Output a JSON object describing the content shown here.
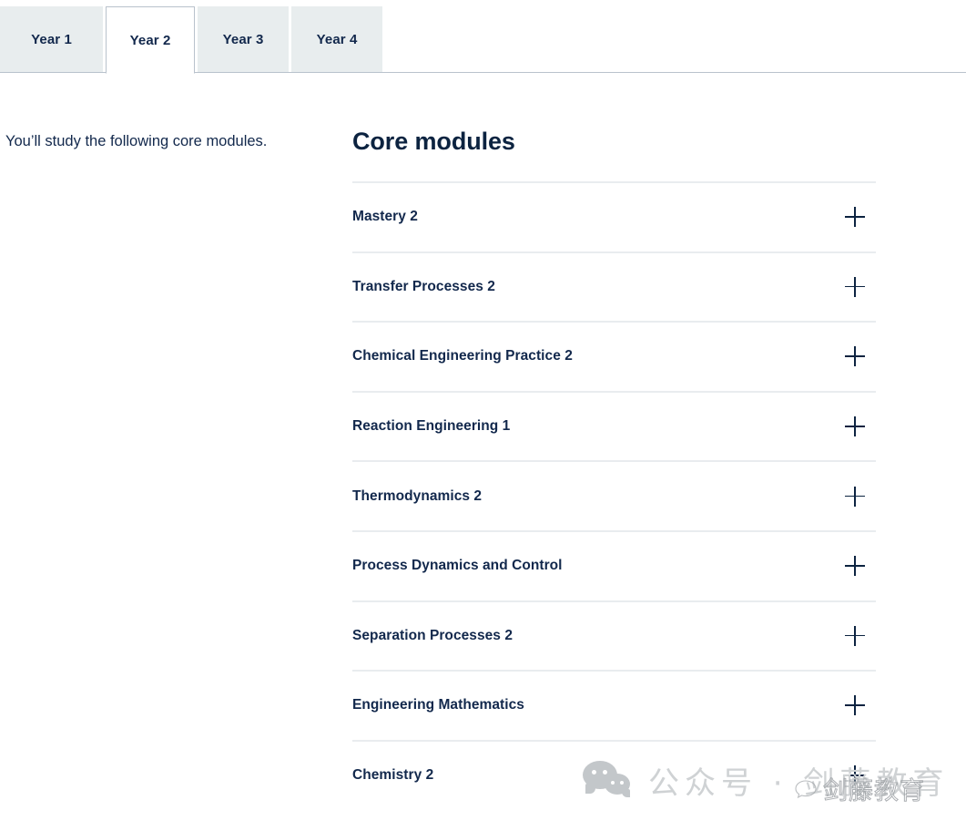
{
  "tabs": {
    "items": [
      {
        "label": "Year 1",
        "active": false
      },
      {
        "label": "Year 2",
        "active": true
      },
      {
        "label": "Year 3",
        "active": false
      },
      {
        "label": "Year 4",
        "active": false
      }
    ]
  },
  "left": {
    "intro": "You’ll study the following core modules."
  },
  "main": {
    "section_title": "Core modules",
    "modules": [
      {
        "title": "Mastery 2",
        "expand_icon": "plus-icon"
      },
      {
        "title": "Transfer Processes 2",
        "expand_icon": "plus-icon"
      },
      {
        "title": "Chemical Engineering Practice 2",
        "expand_icon": "plus-icon"
      },
      {
        "title": "Reaction Engineering 1",
        "expand_icon": "plus-icon"
      },
      {
        "title": "Thermodynamics 2",
        "expand_icon": "plus-icon"
      },
      {
        "title": "Process Dynamics and Control",
        "expand_icon": "plus-icon"
      },
      {
        "title": "Separation Processes 2",
        "expand_icon": "plus-icon"
      },
      {
        "title": "Engineering Mathematics",
        "expand_icon": "plus-icon"
      },
      {
        "title": "Chemistry 2",
        "expand_icon": "plus-icon"
      }
    ]
  },
  "watermarks": {
    "primary_text": "公众号 · 剑藤教育",
    "primary_icon": "wechat-logo-icon",
    "secondary_text": "剑藤教育",
    "secondary_icon": "chat-bubble-outline-icon"
  },
  "colors": {
    "navy": "#0c2340",
    "tab_inactive_bg": "#e8edee",
    "tab_border": "#b9c2cc",
    "divider": "#e9ecef",
    "watermark_gray": "#cfd2d4"
  }
}
